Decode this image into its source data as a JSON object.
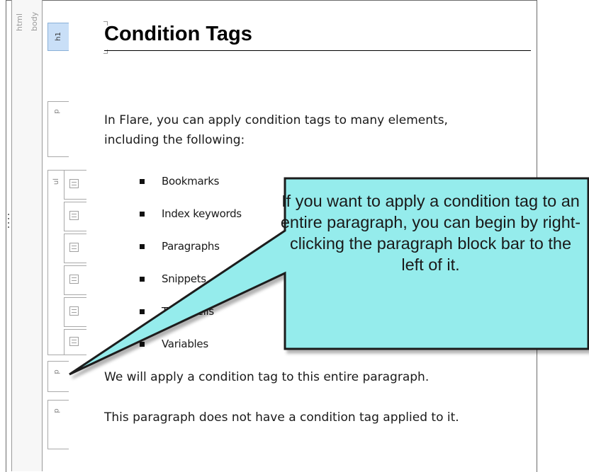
{
  "structure_bars": {
    "html_label": "html",
    "body_label": "body",
    "h1_label": "h1",
    "p_label": "p",
    "ul_label": "ul"
  },
  "document": {
    "title": "Condition Tags",
    "intro": "In Flare, you can apply condition tags to many elements, including the following:",
    "list_items": [
      "Bookmarks",
      "Index keywords",
      "Paragraphs",
      "Snippets",
      "Table cells",
      "Variables"
    ],
    "paragraph_apply": "We will apply a condition tag to this entire paragraph.",
    "paragraph_none": "This paragraph does not have a condition tag applied to it."
  },
  "callout": {
    "text": "If you want to apply a condition tag to an entire paragraph, you can begin by right-clicking the paragraph block bar to the left of it.",
    "fill_color": "#95ecec",
    "border_color": "#1a1a1a"
  }
}
